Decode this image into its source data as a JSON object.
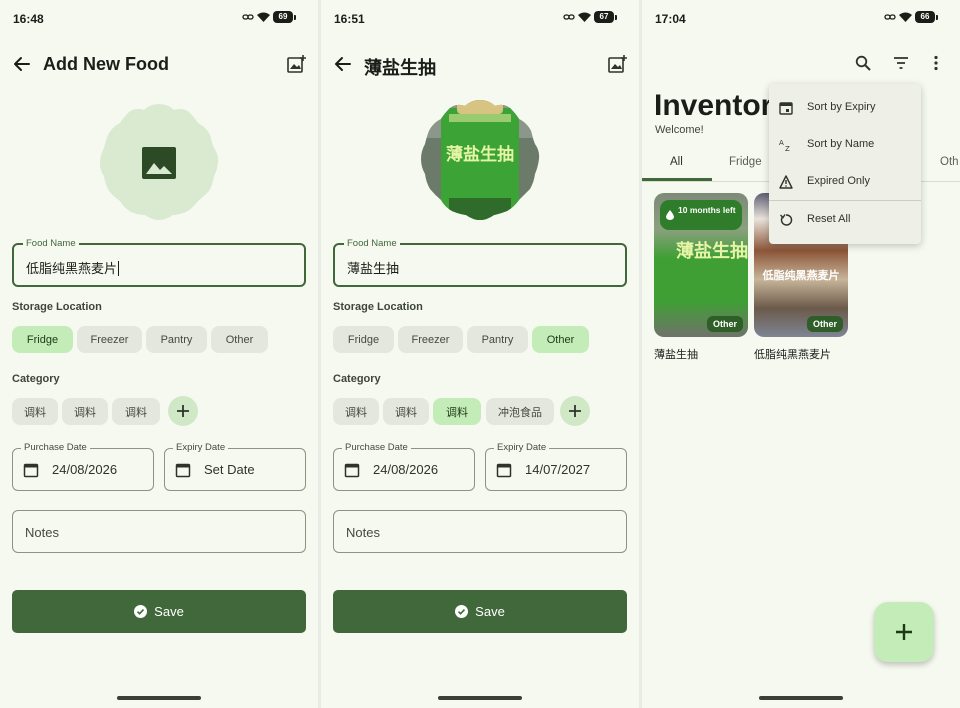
{
  "screens": [
    {
      "status": {
        "time": "16:48",
        "battery": "69"
      },
      "title": "Add New Food",
      "food_name": {
        "label": "Food Name",
        "value": "低脂纯黑燕麦片"
      },
      "storage_label": "Storage Location",
      "storage": [
        "Fridge",
        "Freezer",
        "Pantry",
        "Other"
      ],
      "storage_selected": "Fridge",
      "category_label": "Category",
      "categories": [
        "调料",
        "调料",
        "调料"
      ],
      "category_selected": null,
      "purchase": {
        "label": "Purchase Date",
        "value": "24/08/2026"
      },
      "expiry": {
        "label": "Expiry Date",
        "value": "Set Date"
      },
      "notes_placeholder": "Notes",
      "save_label": "Save"
    },
    {
      "status": {
        "time": "16:51",
        "battery": "67"
      },
      "title": "薄盐生抽",
      "food_name": {
        "label": "Food Name",
        "value": "薄盐生抽"
      },
      "storage_label": "Storage Location",
      "storage": [
        "Fridge",
        "Freezer",
        "Pantry",
        "Other"
      ],
      "storage_selected": "Other",
      "category_label": "Category",
      "categories": [
        "调料",
        "调料",
        "调料",
        "冲泡食品"
      ],
      "category_selected": 2,
      "purchase": {
        "label": "Purchase Date",
        "value": "24/08/2026"
      },
      "expiry": {
        "label": "Expiry Date",
        "value": "14/07/2027"
      },
      "notes_placeholder": "Notes",
      "save_label": "Save",
      "photo_text": "薄盐生抽"
    }
  ],
  "inventory": {
    "status": {
      "time": "17:04",
      "battery": "66"
    },
    "title": "Inventory",
    "subtitle": "Welcome!",
    "tabs": [
      "All",
      "Fridge",
      "Oth"
    ],
    "items": [
      {
        "name": "薄盐生抽",
        "location": "Other",
        "expiry_badge": "10 months left",
        "photo_text": "薄盐生抽"
      },
      {
        "name": "低脂纯黑燕麦片",
        "location": "Other",
        "photo_text": "低脂纯黑燕麦片"
      }
    ],
    "menu": [
      {
        "label": "Sort by Expiry",
        "icon": "calendar-icon"
      },
      {
        "label": "Sort by Name",
        "icon": "sort-az-icon"
      },
      {
        "label": "Expired Only",
        "icon": "warning-icon"
      },
      {
        "label": "Reset All",
        "icon": "reset-icon"
      }
    ]
  },
  "colors": {
    "primary": "#41683a",
    "chip_selected": "#c4ecb8",
    "background": "#f6f9f0"
  }
}
